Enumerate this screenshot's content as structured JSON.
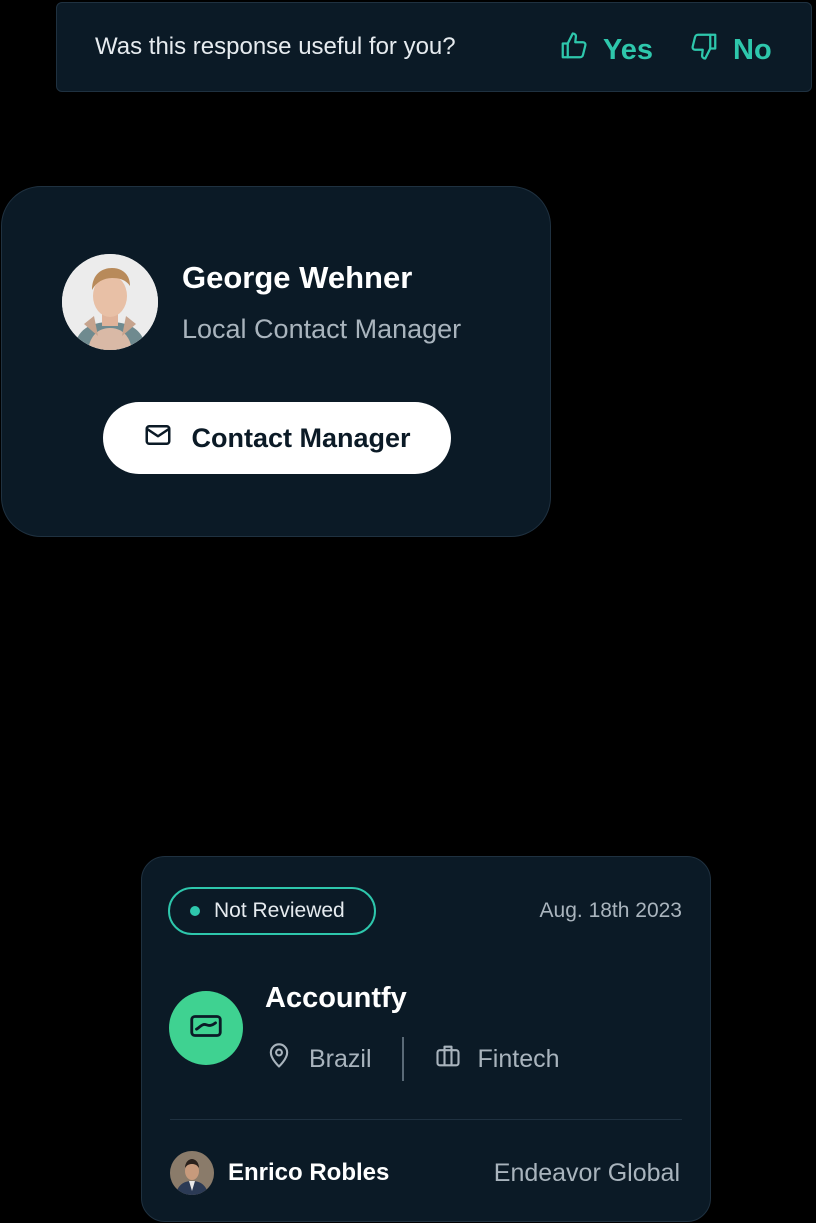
{
  "feedback": {
    "question": "Was this response useful for you?",
    "yes_label": "Yes",
    "no_label": "No",
    "accent_color": "#2ec7ac"
  },
  "contact_card": {
    "name": "George Wehner",
    "role": "Local Contact Manager",
    "button_label": "Contact Manager",
    "button_icon": "mail-icon"
  },
  "company_card": {
    "status": "Not Reviewed",
    "date": "Aug. 18th 2023",
    "company_name": "Accountfy",
    "location": "Brazil",
    "industry": "Fintech",
    "contact_name": "Enrico Robles",
    "organization": "Endeavor Global",
    "logo_color": "#3fd291"
  }
}
